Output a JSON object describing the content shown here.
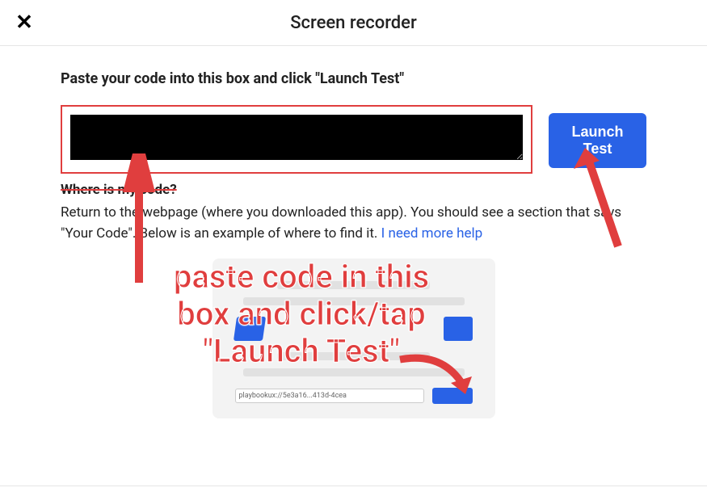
{
  "header": {
    "title": "Screen recorder"
  },
  "main": {
    "instruction": "Paste your code into this box and click \"Launch Test\"",
    "launch_button_label": "Launch Test",
    "subheading": "Where is my code?",
    "help_text_1": "Return to the webpage (where you downloaded this app). You should see a section that says \"Your Code\". Below is an example of where to find it.  ",
    "help_link": "I need more help",
    "example_code_text": "playbookux://5e3a16...413d-4cea"
  },
  "annotation": {
    "overlay_text": "paste code in this box and click/tap \"Launch Test\""
  },
  "colors": {
    "annotation_red": "#e03e3e",
    "primary_blue": "#2962e6"
  }
}
